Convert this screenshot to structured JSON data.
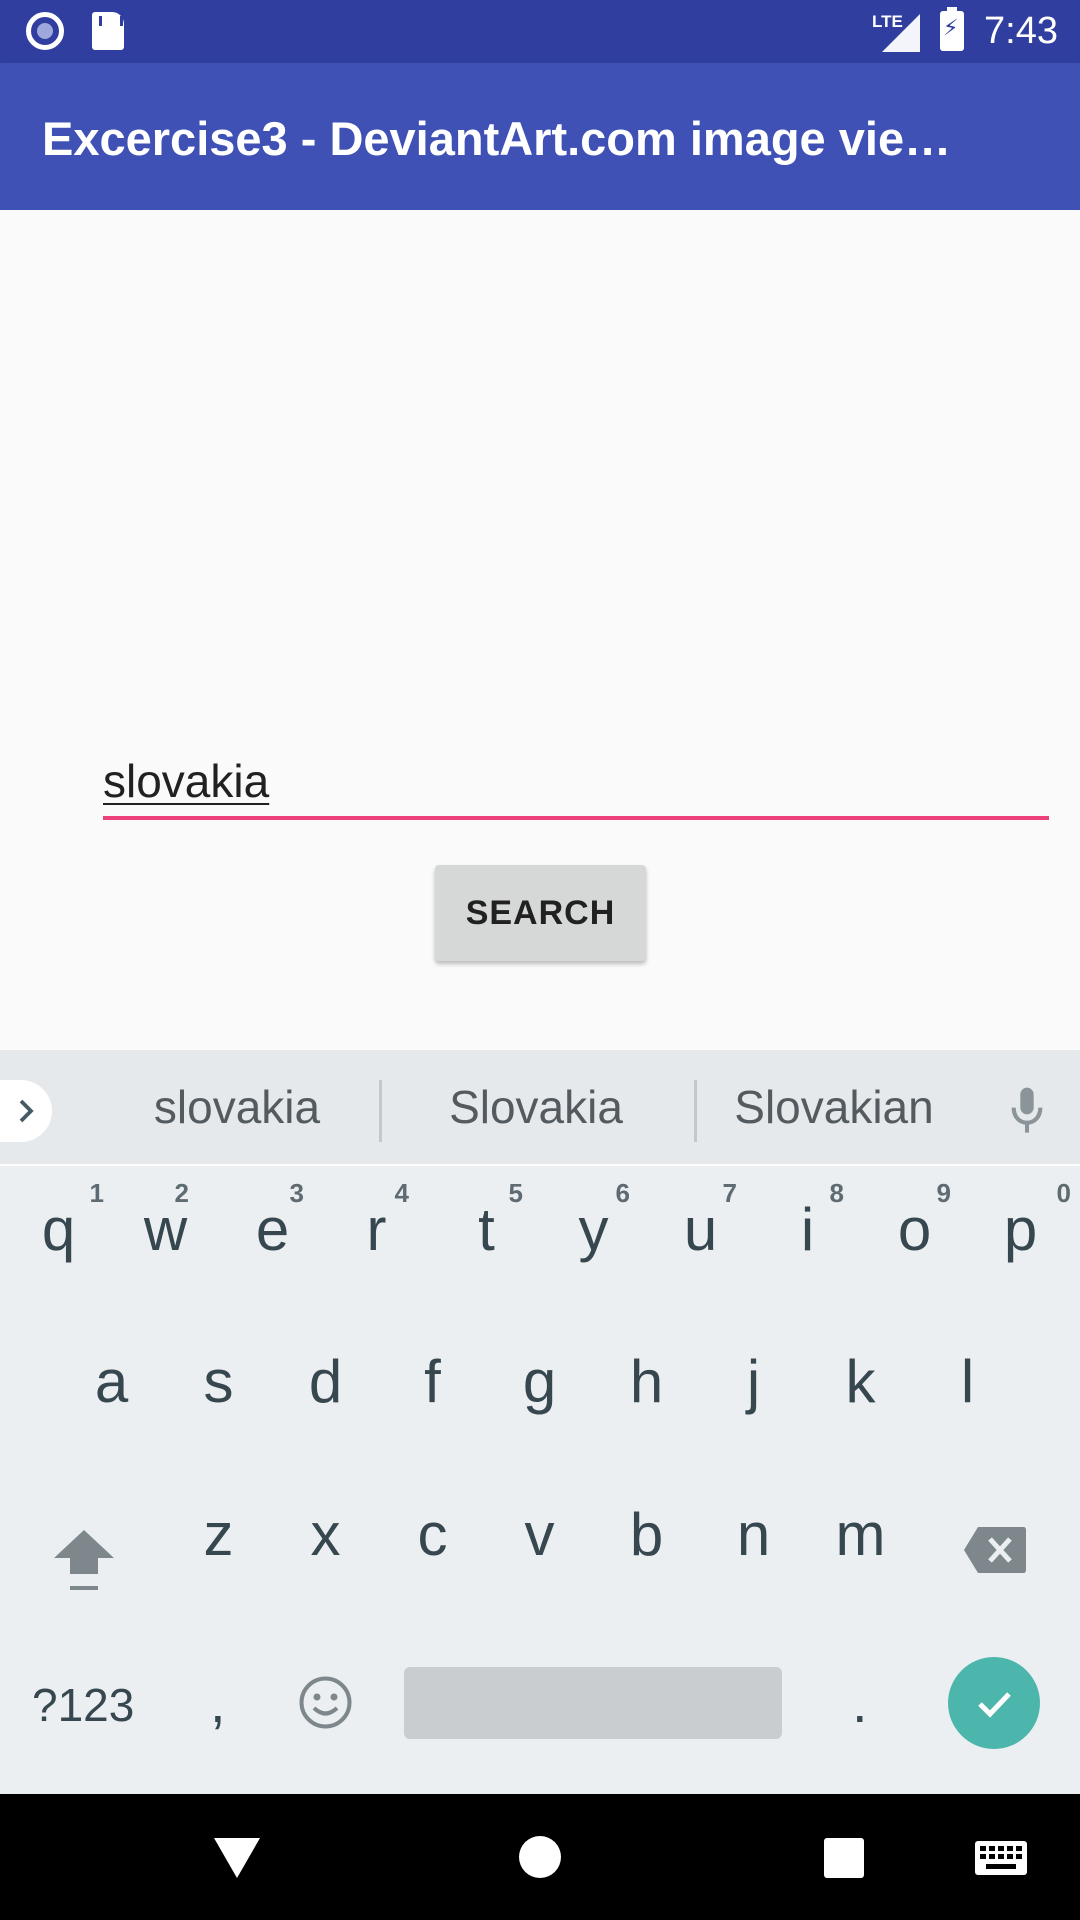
{
  "status_bar": {
    "time": "7:43",
    "network": "LTE",
    "icons": [
      "record-icon",
      "sd-card-icon",
      "signal-icon",
      "battery-charging-icon"
    ]
  },
  "app_bar": {
    "title": "Excercise3 - DeviantArt.com image vie…"
  },
  "form": {
    "search_value": "slovakia",
    "search_button_label": "SEARCH",
    "accent_color": "#ec407a"
  },
  "keyboard": {
    "suggestions": [
      "slovakia",
      "Slovakia",
      "Slovakian"
    ],
    "row1": [
      {
        "key": "q",
        "hint": "1"
      },
      {
        "key": "w",
        "hint": "2"
      },
      {
        "key": "e",
        "hint": "3"
      },
      {
        "key": "r",
        "hint": "4"
      },
      {
        "key": "t",
        "hint": "5"
      },
      {
        "key": "y",
        "hint": "6"
      },
      {
        "key": "u",
        "hint": "7"
      },
      {
        "key": "i",
        "hint": "8"
      },
      {
        "key": "o",
        "hint": "9"
      },
      {
        "key": "p",
        "hint": "0"
      }
    ],
    "row2": [
      "a",
      "s",
      "d",
      "f",
      "g",
      "h",
      "j",
      "k",
      "l"
    ],
    "row3": [
      "z",
      "x",
      "c",
      "v",
      "b",
      "n",
      "m"
    ],
    "symbols_label": "?123",
    "comma": ",",
    "period": ".",
    "done_color": "#4db6ac"
  },
  "nav_bar": {
    "icons": [
      "back-icon",
      "home-icon",
      "recents-icon",
      "keyboard-switch-icon"
    ]
  },
  "colors": {
    "status_bar": "#303f9f",
    "app_bar": "#3f51b5",
    "background": "#fafafa"
  }
}
